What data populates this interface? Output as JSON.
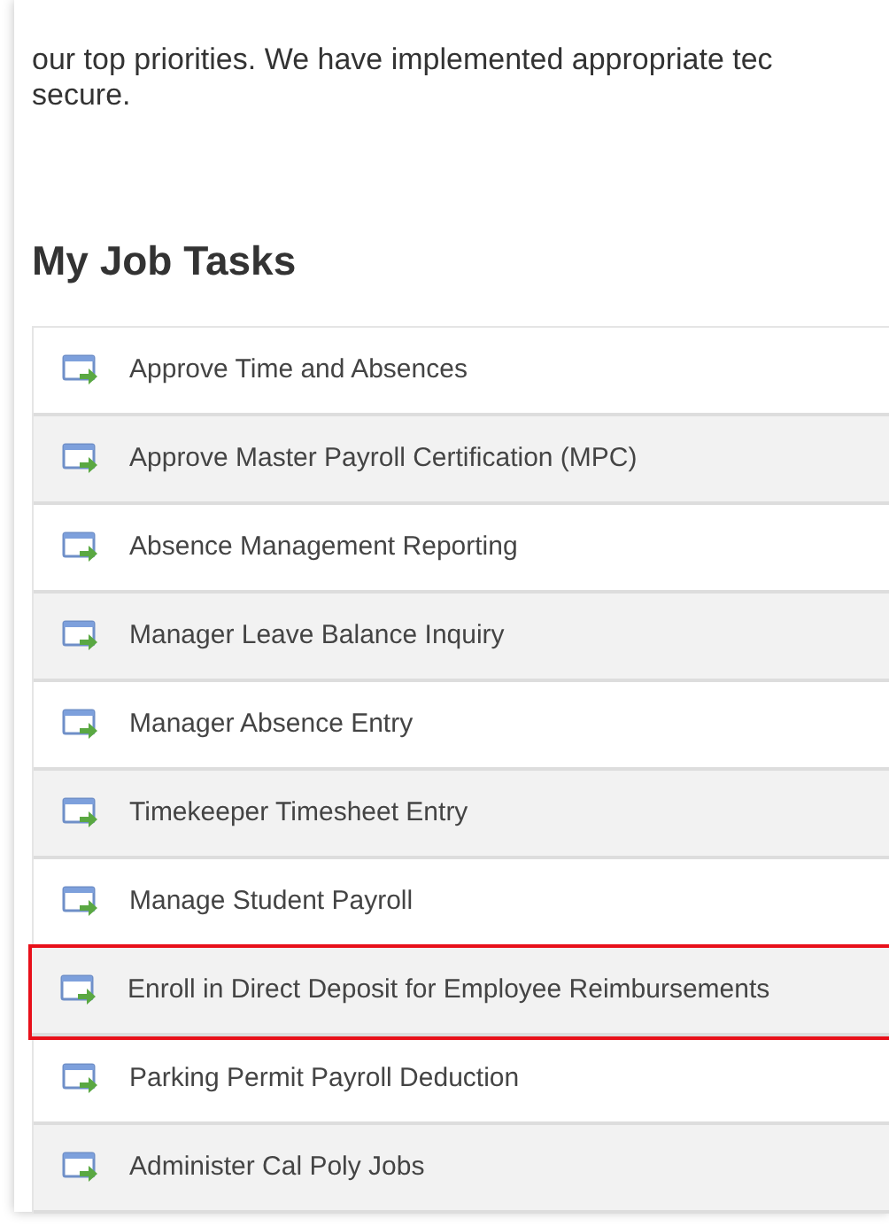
{
  "intro": {
    "lines": [
      "our top priorities. We have implemented appropriate tec",
      "secure."
    ]
  },
  "heading": "My Job Tasks",
  "tasks": [
    {
      "label": "Approve Time and Absences",
      "highlighted": false
    },
    {
      "label": "Approve Master Payroll Certification (MPC)",
      "highlighted": false
    },
    {
      "label": "Absence Management Reporting",
      "highlighted": false
    },
    {
      "label": "Manager Leave Balance Inquiry",
      "highlighted": false
    },
    {
      "label": "Manager Absence Entry",
      "highlighted": false
    },
    {
      "label": "Timekeeper Timesheet Entry",
      "highlighted": false
    },
    {
      "label": "Manage Student Payroll",
      "highlighted": false
    },
    {
      "label": "Enroll in Direct Deposit for Employee Reimbursements",
      "highlighted": true
    },
    {
      "label": "Parking Permit Payroll Deduction",
      "highlighted": false
    },
    {
      "label": "Administer Cal Poly Jobs",
      "highlighted": false
    }
  ]
}
